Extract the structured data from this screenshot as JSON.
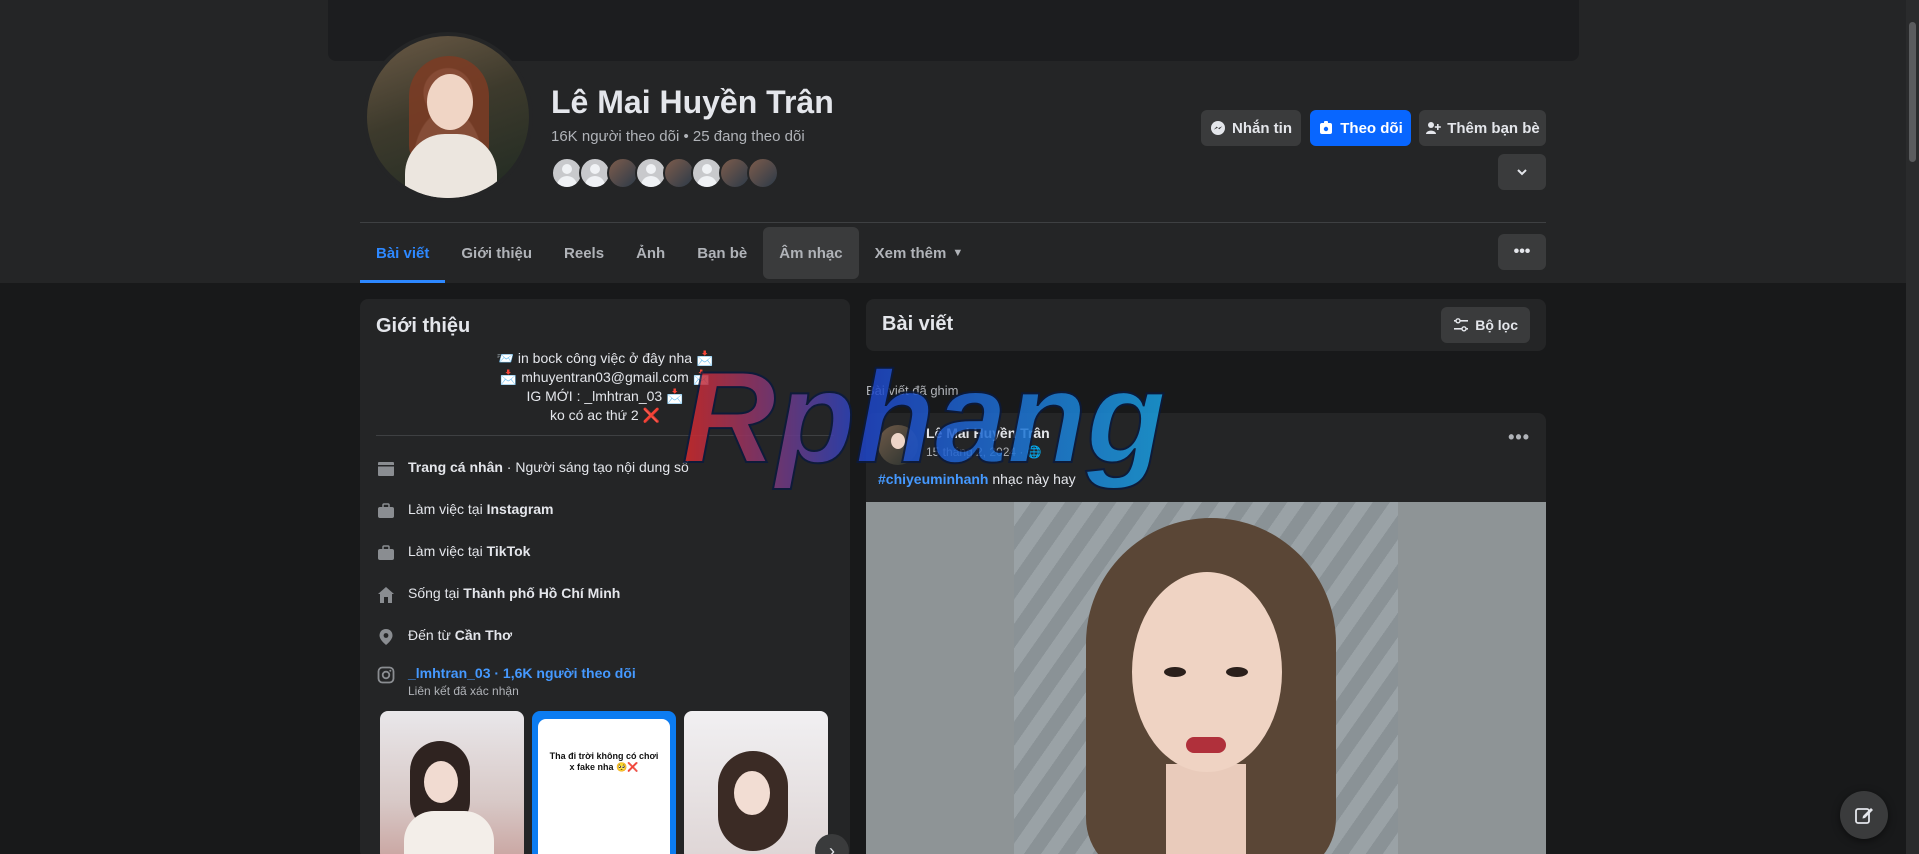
{
  "profile": {
    "name": "Lê Mai Huyền Trân",
    "stats": "16K người theo dõi • 25 đang theo dõi"
  },
  "actions": {
    "message": "Nhắn tin",
    "follow": "Theo dõi",
    "add_friend": "Thêm bạn bè"
  },
  "tabs": [
    {
      "label": "Bài viết"
    },
    {
      "label": "Giới thiệu"
    },
    {
      "label": "Reels"
    },
    {
      "label": "Ảnh"
    },
    {
      "label": "Bạn bè"
    },
    {
      "label": "Âm nhạc"
    },
    {
      "label": "Xem thêm"
    }
  ],
  "intro": {
    "title": "Giới thiệu",
    "bio": [
      "📨 in bock công việc ở đây nha 📩",
      "📩 mhuyentran03@gmail.com 📩",
      "IG MỚI : _lmhtran_03 📩",
      "ko có ac thứ 2 ❌"
    ],
    "rows": [
      {
        "icon": "flag-icon",
        "prefix": "",
        "bold": "Trang cá nhân",
        "suffix": " · Người sáng tạo nội dung số"
      },
      {
        "icon": "briefcase-icon",
        "prefix": "Làm việc tại ",
        "bold": "Instagram",
        "suffix": ""
      },
      {
        "icon": "briefcase-icon",
        "prefix": "Làm việc tại ",
        "bold": "TikTok",
        "suffix": ""
      },
      {
        "icon": "home-icon",
        "prefix": "Sống tại ",
        "bold": "Thành phố Hồ Chí Minh",
        "suffix": ""
      },
      {
        "icon": "location-pin-icon",
        "prefix": "Đến từ ",
        "bold": "Cần Thơ",
        "suffix": ""
      }
    ],
    "instagram": {
      "link": "_lmhtran_03 · 1,6K người theo dõi",
      "sub": "Liên kết đã xác nhận"
    },
    "thumb2_title": "Tha đi trời không có chơi x fake nha 🥺❌"
  },
  "posts": {
    "title": "Bài viết",
    "filter": "Bộ lọc",
    "pinned_label": "Bài viết đã ghim",
    "post": {
      "author": "Lê Mai Huyền Trân",
      "date": "15 tháng 2, 2024 · ",
      "hashtag": "#chiyeuminhanh",
      "text": " nhạc này hay"
    }
  },
  "watermark": {
    "text": "Rphang"
  },
  "colors": {
    "background": "#18191a",
    "card": "#242526",
    "accent": "#0866ff",
    "link": "#4599ff"
  }
}
